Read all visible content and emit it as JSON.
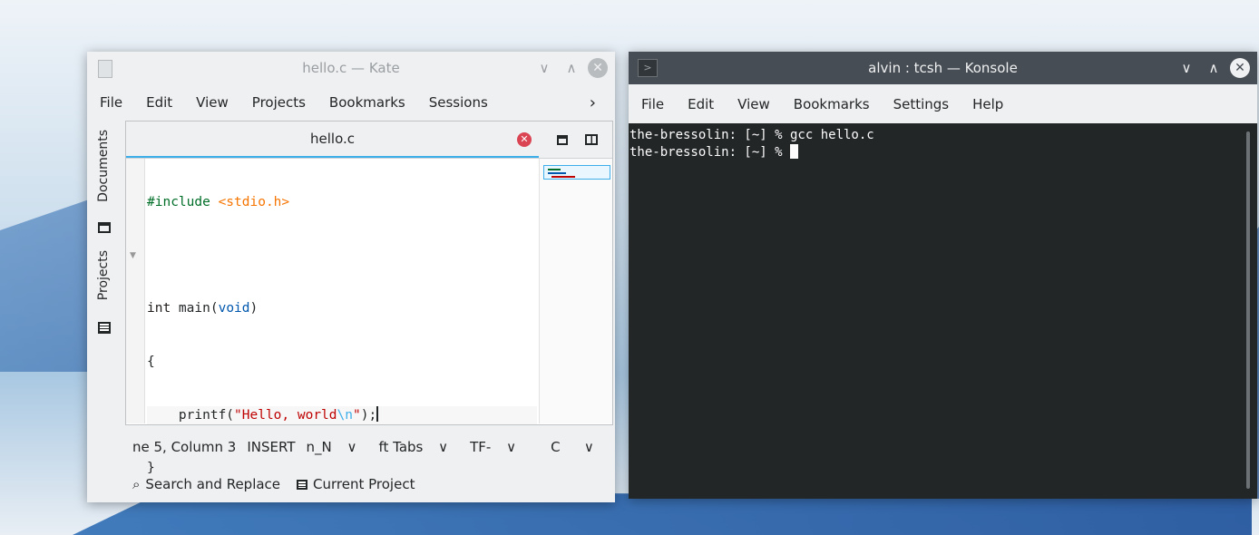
{
  "kate": {
    "title": "hello.c — Kate",
    "menu": [
      "File",
      "Edit",
      "View",
      "Projects",
      "Bookmarks",
      "Sessions"
    ],
    "menu_more": "›",
    "sidebar": {
      "documents": "Documents",
      "projects": "Projects"
    },
    "tab": {
      "label": "hello.c",
      "close": "✕"
    },
    "code": {
      "line1_pp": "#include ",
      "line1_inc": "<stdio.h>",
      "line3_kw": "int",
      " line3_mid": " main(",
      "line3_ty": "void",
      "line3_end": ")",
      "line4": "{",
      "line5_pre": "    printf(",
      "line5_str": "\"Hello, world",
      "line5_esc": "\\n",
      "line5_str2": "\"",
      "line5_end": ");",
      "line6": "}"
    },
    "status": {
      "position": "ne 5, Column 3",
      "mode": "INSERT",
      "dict": "n_N",
      "indent": "ft Tabs",
      "encoding": "TF-",
      "syntax": "C"
    },
    "bottom": {
      "search": "Search and Replace",
      "project": "Current Project"
    }
  },
  "konsole": {
    "title": "alvin : tcsh — Konsole",
    "menu": [
      "File",
      "Edit",
      "View",
      "Bookmarks",
      "Settings",
      "Help"
    ],
    "lines": [
      "the-bressolin: [~] % gcc hello.c",
      "the-bressolin: [~] % "
    ]
  }
}
